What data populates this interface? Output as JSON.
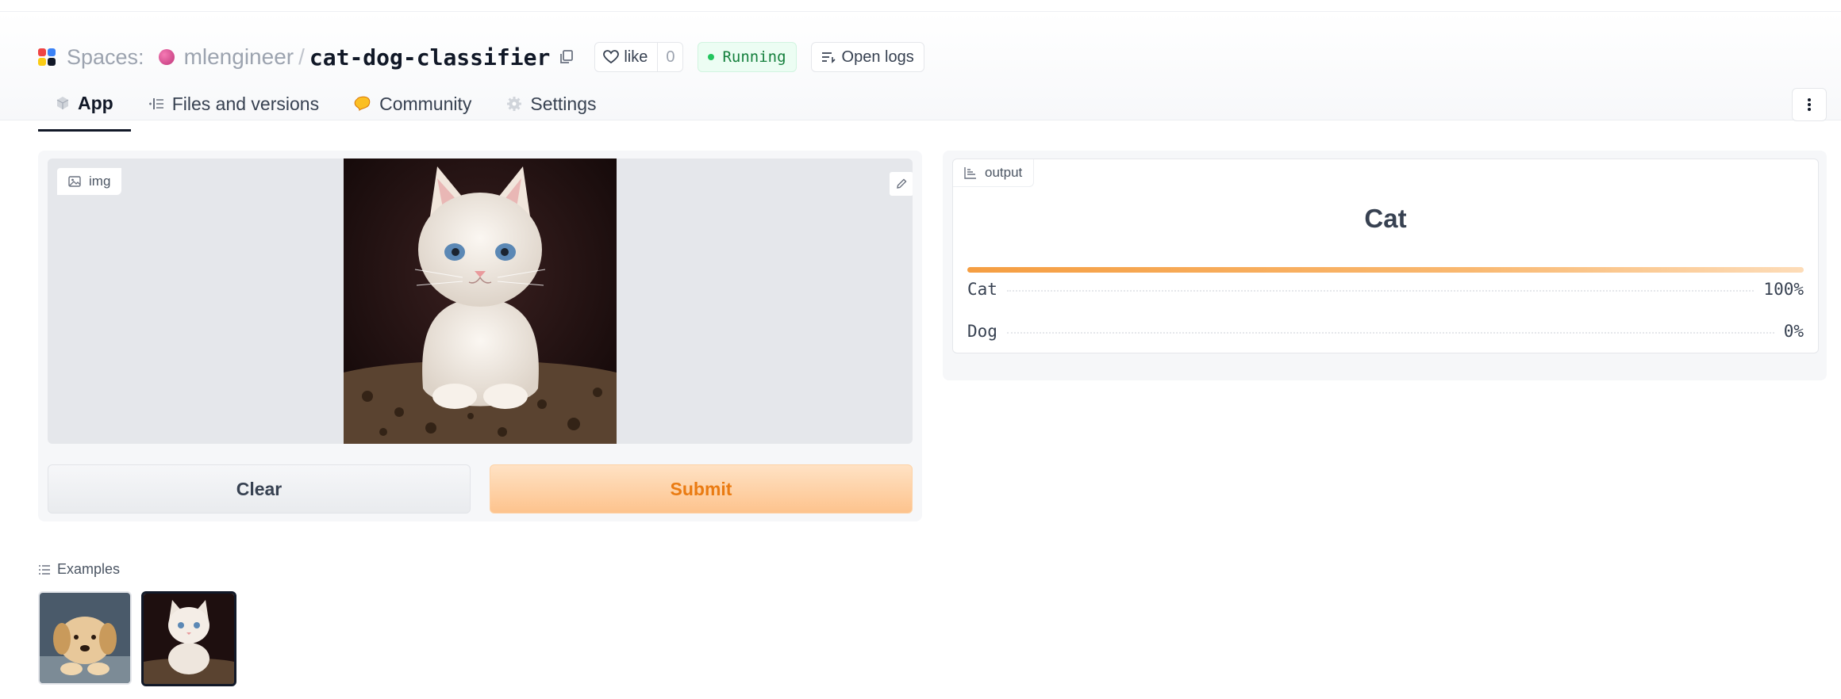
{
  "header": {
    "spaces_label": "Spaces:",
    "owner": "mlengineer",
    "separator": "/",
    "repo": "cat-dog-classifier",
    "like_label": "like",
    "like_count": "0",
    "status": "Running",
    "logs_label": "Open logs"
  },
  "tabs": [
    {
      "label": "App",
      "icon": "cube-icon",
      "active": true
    },
    {
      "label": "Files and versions",
      "icon": "files-icon"
    },
    {
      "label": "Community",
      "icon": "community-icon"
    },
    {
      "label": "Settings",
      "icon": "gear-icon"
    }
  ],
  "input": {
    "label": "img",
    "image": "cat photo"
  },
  "buttons": {
    "clear": "Clear",
    "submit": "Submit"
  },
  "output": {
    "label": "output",
    "prediction": "Cat",
    "confidences": [
      {
        "label": "Cat",
        "value": "100%"
      },
      {
        "label": "Dog",
        "value": "0%"
      }
    ]
  },
  "examples": {
    "label": "Examples",
    "items": [
      {
        "image": "golden retriever puppy",
        "selected": false
      },
      {
        "image": "white kitten",
        "selected": true
      }
    ]
  },
  "colors": {
    "accent": "#f59e42",
    "submit_text": "#ea7b12",
    "running_green": "#22c55e"
  }
}
